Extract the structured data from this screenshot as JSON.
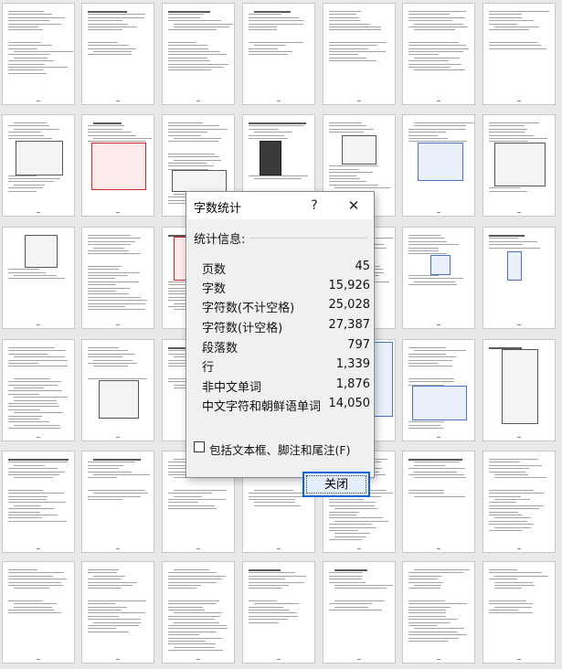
{
  "dialog": {
    "title": "字数统计",
    "help_glyph": "?",
    "close_glyph": "✕",
    "section_label": "统计信息:",
    "stats": [
      {
        "label": "页数",
        "value": "45"
      },
      {
        "label": "字数",
        "value": "15,926"
      },
      {
        "label": "字符数(不计空格)",
        "value": "25,028"
      },
      {
        "label": "字符数(计空格)",
        "value": "27,387"
      },
      {
        "label": "段落数",
        "value": "797"
      },
      {
        "label": "行",
        "value": "1,339"
      },
      {
        "label": "非中文单词",
        "value": "1,876"
      },
      {
        "label": "中文字符和朝鲜语单词",
        "value": "14,050"
      }
    ],
    "checkbox_label": "包括文本框、脚注和尾注(F)",
    "checkbox_checked": false,
    "close_button_label": "关闭"
  }
}
